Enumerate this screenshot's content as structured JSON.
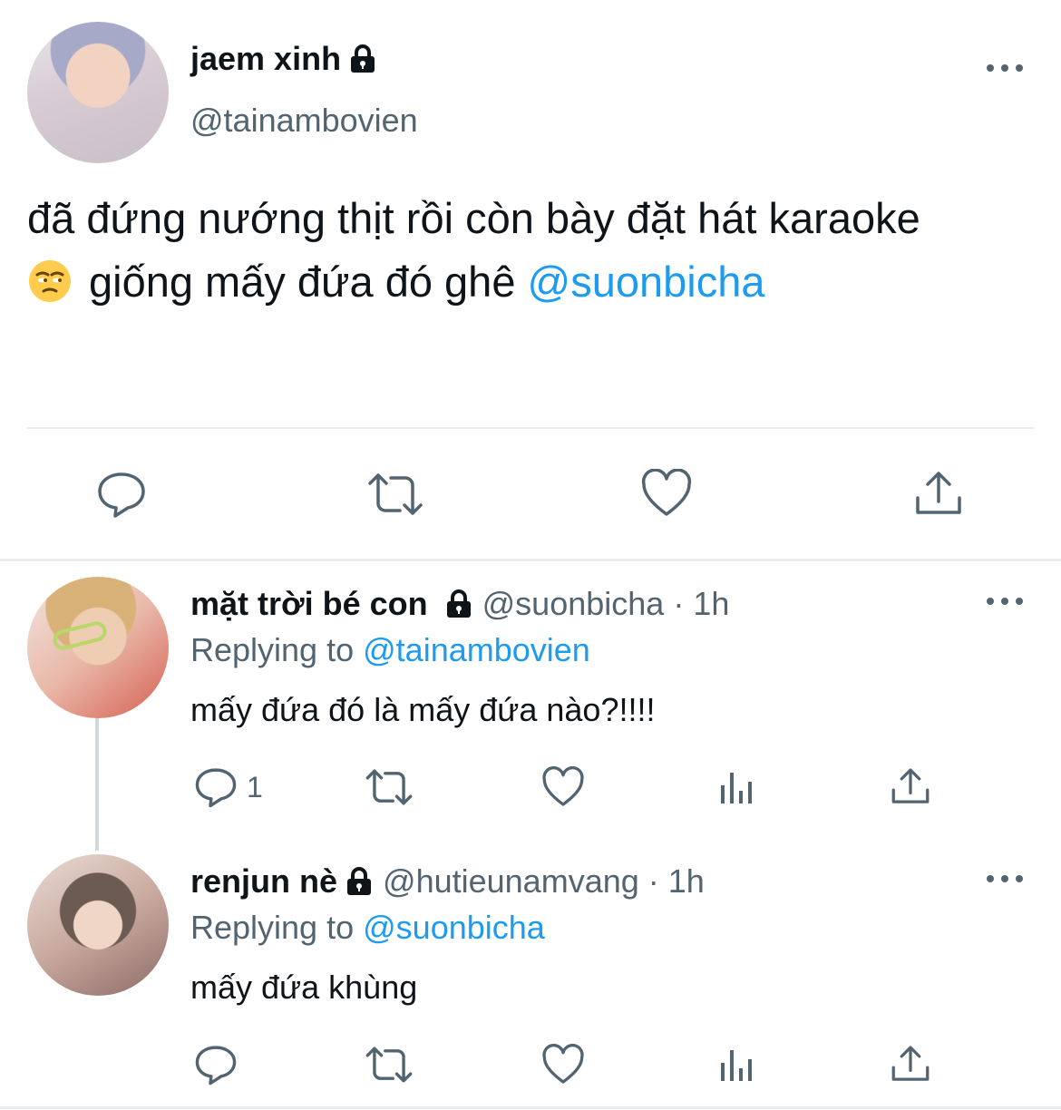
{
  "main_tweet": {
    "display_name": "jaem xinh",
    "handle": "@tainambovien",
    "text_line1": "đã đứng nướng thịt rồi còn bày đặt hát karaoke",
    "text_line2": "giống mấy đứa đó ghê",
    "mention": "@suonbicha",
    "emoji_icon": "unamused-face-icon",
    "locked": true
  },
  "replies": [
    {
      "display_name": "mặt trời bé con",
      "handle": "@suonbicha",
      "dot": "·",
      "time": "1h",
      "replying_label": "Replying to",
      "replying_to": "@tainambovien",
      "text": "mấy đứa đó là mấy đứa nào?!!!!",
      "reply_count": "1",
      "locked": true
    },
    {
      "display_name": "renjun nè",
      "handle": "@hutieunamvang",
      "dot": "·",
      "time": "1h",
      "replying_label": "Replying to",
      "replying_to": "@suonbicha",
      "text": "mấy đứa khùng",
      "reply_count": "",
      "locked": true
    }
  ],
  "colors": {
    "text": "#0f1419",
    "secondary": "#536471",
    "link": "#1d9bf0",
    "divider": "#e7ecef"
  }
}
